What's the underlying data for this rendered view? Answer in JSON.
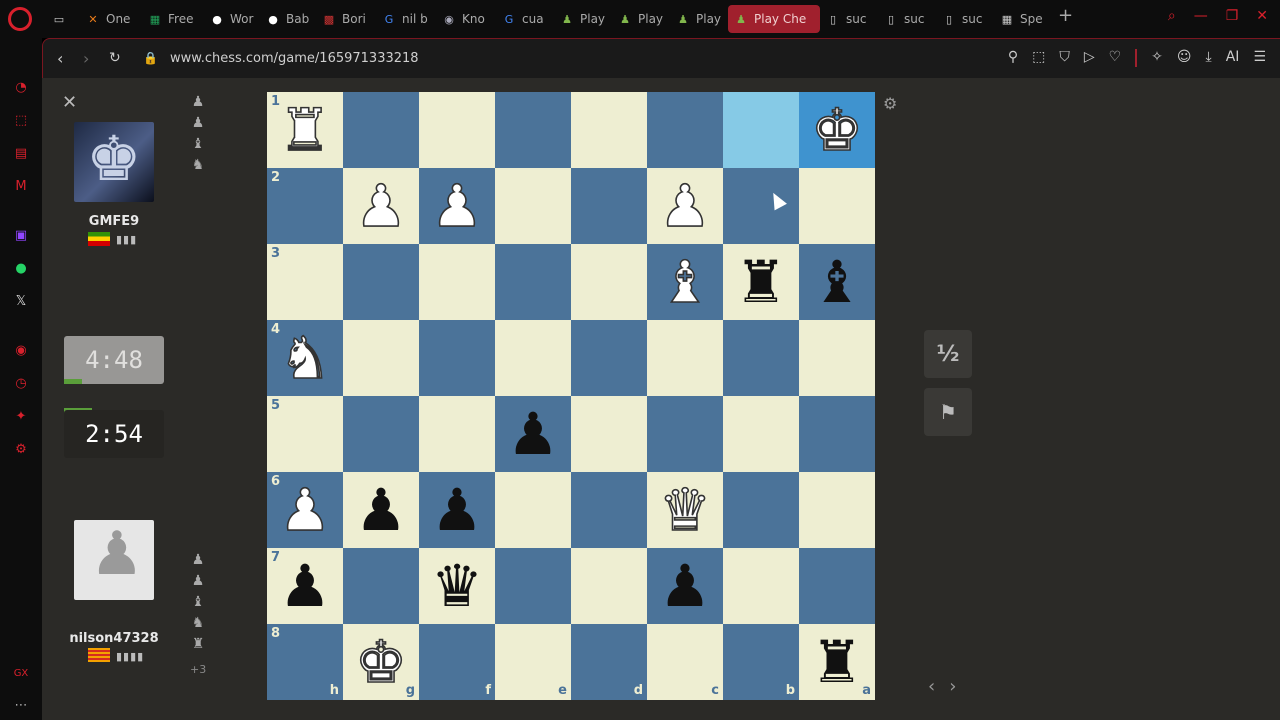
{
  "browser": {
    "tabs": [
      {
        "label": "",
        "icon": "tv-icon",
        "active": false
      },
      {
        "label": "One",
        "icon": "jira-icon",
        "active": false
      },
      {
        "label": "Free",
        "icon": "sheets-icon",
        "active": false
      },
      {
        "label": "Wor",
        "icon": "dot-icon",
        "active": false
      },
      {
        "label": "Bab",
        "icon": "dot-icon",
        "active": false
      },
      {
        "label": "Bori",
        "icon": "checker-icon",
        "active": false
      },
      {
        "label": "nil b",
        "icon": "google-icon",
        "active": false
      },
      {
        "label": "Kno",
        "icon": "book-icon",
        "active": false
      },
      {
        "label": "cua",
        "icon": "google-icon",
        "active": false
      },
      {
        "label": "Play",
        "icon": "pawn-icon",
        "active": false
      },
      {
        "label": "Play",
        "icon": "pawn-icon",
        "active": false
      },
      {
        "label": "Play",
        "icon": "pawn-icon",
        "active": false
      },
      {
        "label": "Play Che",
        "icon": "pawn-icon",
        "active": true
      },
      {
        "label": "suc",
        "icon": "doc-icon",
        "active": false
      },
      {
        "label": "suc",
        "icon": "doc-icon",
        "active": false
      },
      {
        "label": "suc",
        "icon": "doc-icon",
        "active": false
      },
      {
        "label": "Spe",
        "icon": "grid-icon",
        "active": false
      }
    ],
    "url": "www.chess.com/game/165971333218",
    "ai_label": "AI"
  },
  "players": {
    "opponent": {
      "name": "GMFE9",
      "clock": "4:48",
      "rating_bars": "▮▮▮",
      "clock_fill": 0.18
    },
    "me": {
      "name": "nilson47328",
      "clock": "2:54",
      "rating_bars": "▮▮▮▮",
      "clock_fill": 0.28,
      "captured_extra": "+3"
    }
  },
  "board": {
    "ranks": [
      "1",
      "2",
      "3",
      "4",
      "5",
      "6",
      "7",
      "8"
    ],
    "files": [
      "h",
      "g",
      "f",
      "e",
      "d",
      "c",
      "b",
      "a"
    ],
    "highlight": [
      [
        0,
        6
      ],
      [
        0,
        7
      ]
    ],
    "pieces": [
      {
        "r": 0,
        "c": 0,
        "p": "♜",
        "col": "w",
        "name": "white-rook-icon"
      },
      {
        "r": 0,
        "c": 7,
        "p": "♚",
        "col": "w",
        "name": "white-king-icon"
      },
      {
        "r": 1,
        "c": 1,
        "p": "♟",
        "col": "w",
        "name": "white-pawn-icon"
      },
      {
        "r": 1,
        "c": 2,
        "p": "♟",
        "col": "w",
        "name": "white-pawn-icon"
      },
      {
        "r": 1,
        "c": 5,
        "p": "♟",
        "col": "w",
        "name": "white-pawn-icon"
      },
      {
        "r": 2,
        "c": 5,
        "p": "♝",
        "col": "w",
        "name": "white-bishop-icon"
      },
      {
        "r": 2,
        "c": 6,
        "p": "♜",
        "col": "b",
        "name": "black-rook-icon"
      },
      {
        "r": 2,
        "c": 7,
        "p": "♝",
        "col": "b",
        "name": "black-bishop-icon"
      },
      {
        "r": 3,
        "c": 0,
        "p": "♞",
        "col": "w",
        "name": "white-knight-icon"
      },
      {
        "r": 4,
        "c": 3,
        "p": "♟",
        "col": "b",
        "name": "black-pawn-icon"
      },
      {
        "r": 5,
        "c": 0,
        "p": "♟",
        "col": "w",
        "name": "white-pawn-icon"
      },
      {
        "r": 5,
        "c": 1,
        "p": "♟",
        "col": "b",
        "name": "black-pawn-icon"
      },
      {
        "r": 5,
        "c": 2,
        "p": "♟",
        "col": "b",
        "name": "black-pawn-icon"
      },
      {
        "r": 5,
        "c": 5,
        "p": "♛",
        "col": "w",
        "name": "white-queen-icon"
      },
      {
        "r": 6,
        "c": 0,
        "p": "♟",
        "col": "b",
        "name": "black-pawn-icon"
      },
      {
        "r": 6,
        "c": 2,
        "p": "♛",
        "col": "b",
        "name": "black-queen-icon"
      },
      {
        "r": 6,
        "c": 5,
        "p": "♟",
        "col": "b",
        "name": "black-pawn-icon"
      },
      {
        "r": 7,
        "c": 1,
        "p": "♚",
        "col": "w",
        "name": "white-king-icon"
      },
      {
        "r": 7,
        "c": 7,
        "p": "♜",
        "col": "b",
        "name": "black-rook-icon"
      }
    ]
  },
  "controls": {
    "draw_label": "½",
    "resign_icon": "flag-icon"
  },
  "colors": {
    "light_square": "#eeeed2",
    "dark_square": "#4b7399",
    "highlight_light": "#86cae6",
    "highlight_dark": "#3f93cf",
    "opera_red": "#d8202c"
  }
}
